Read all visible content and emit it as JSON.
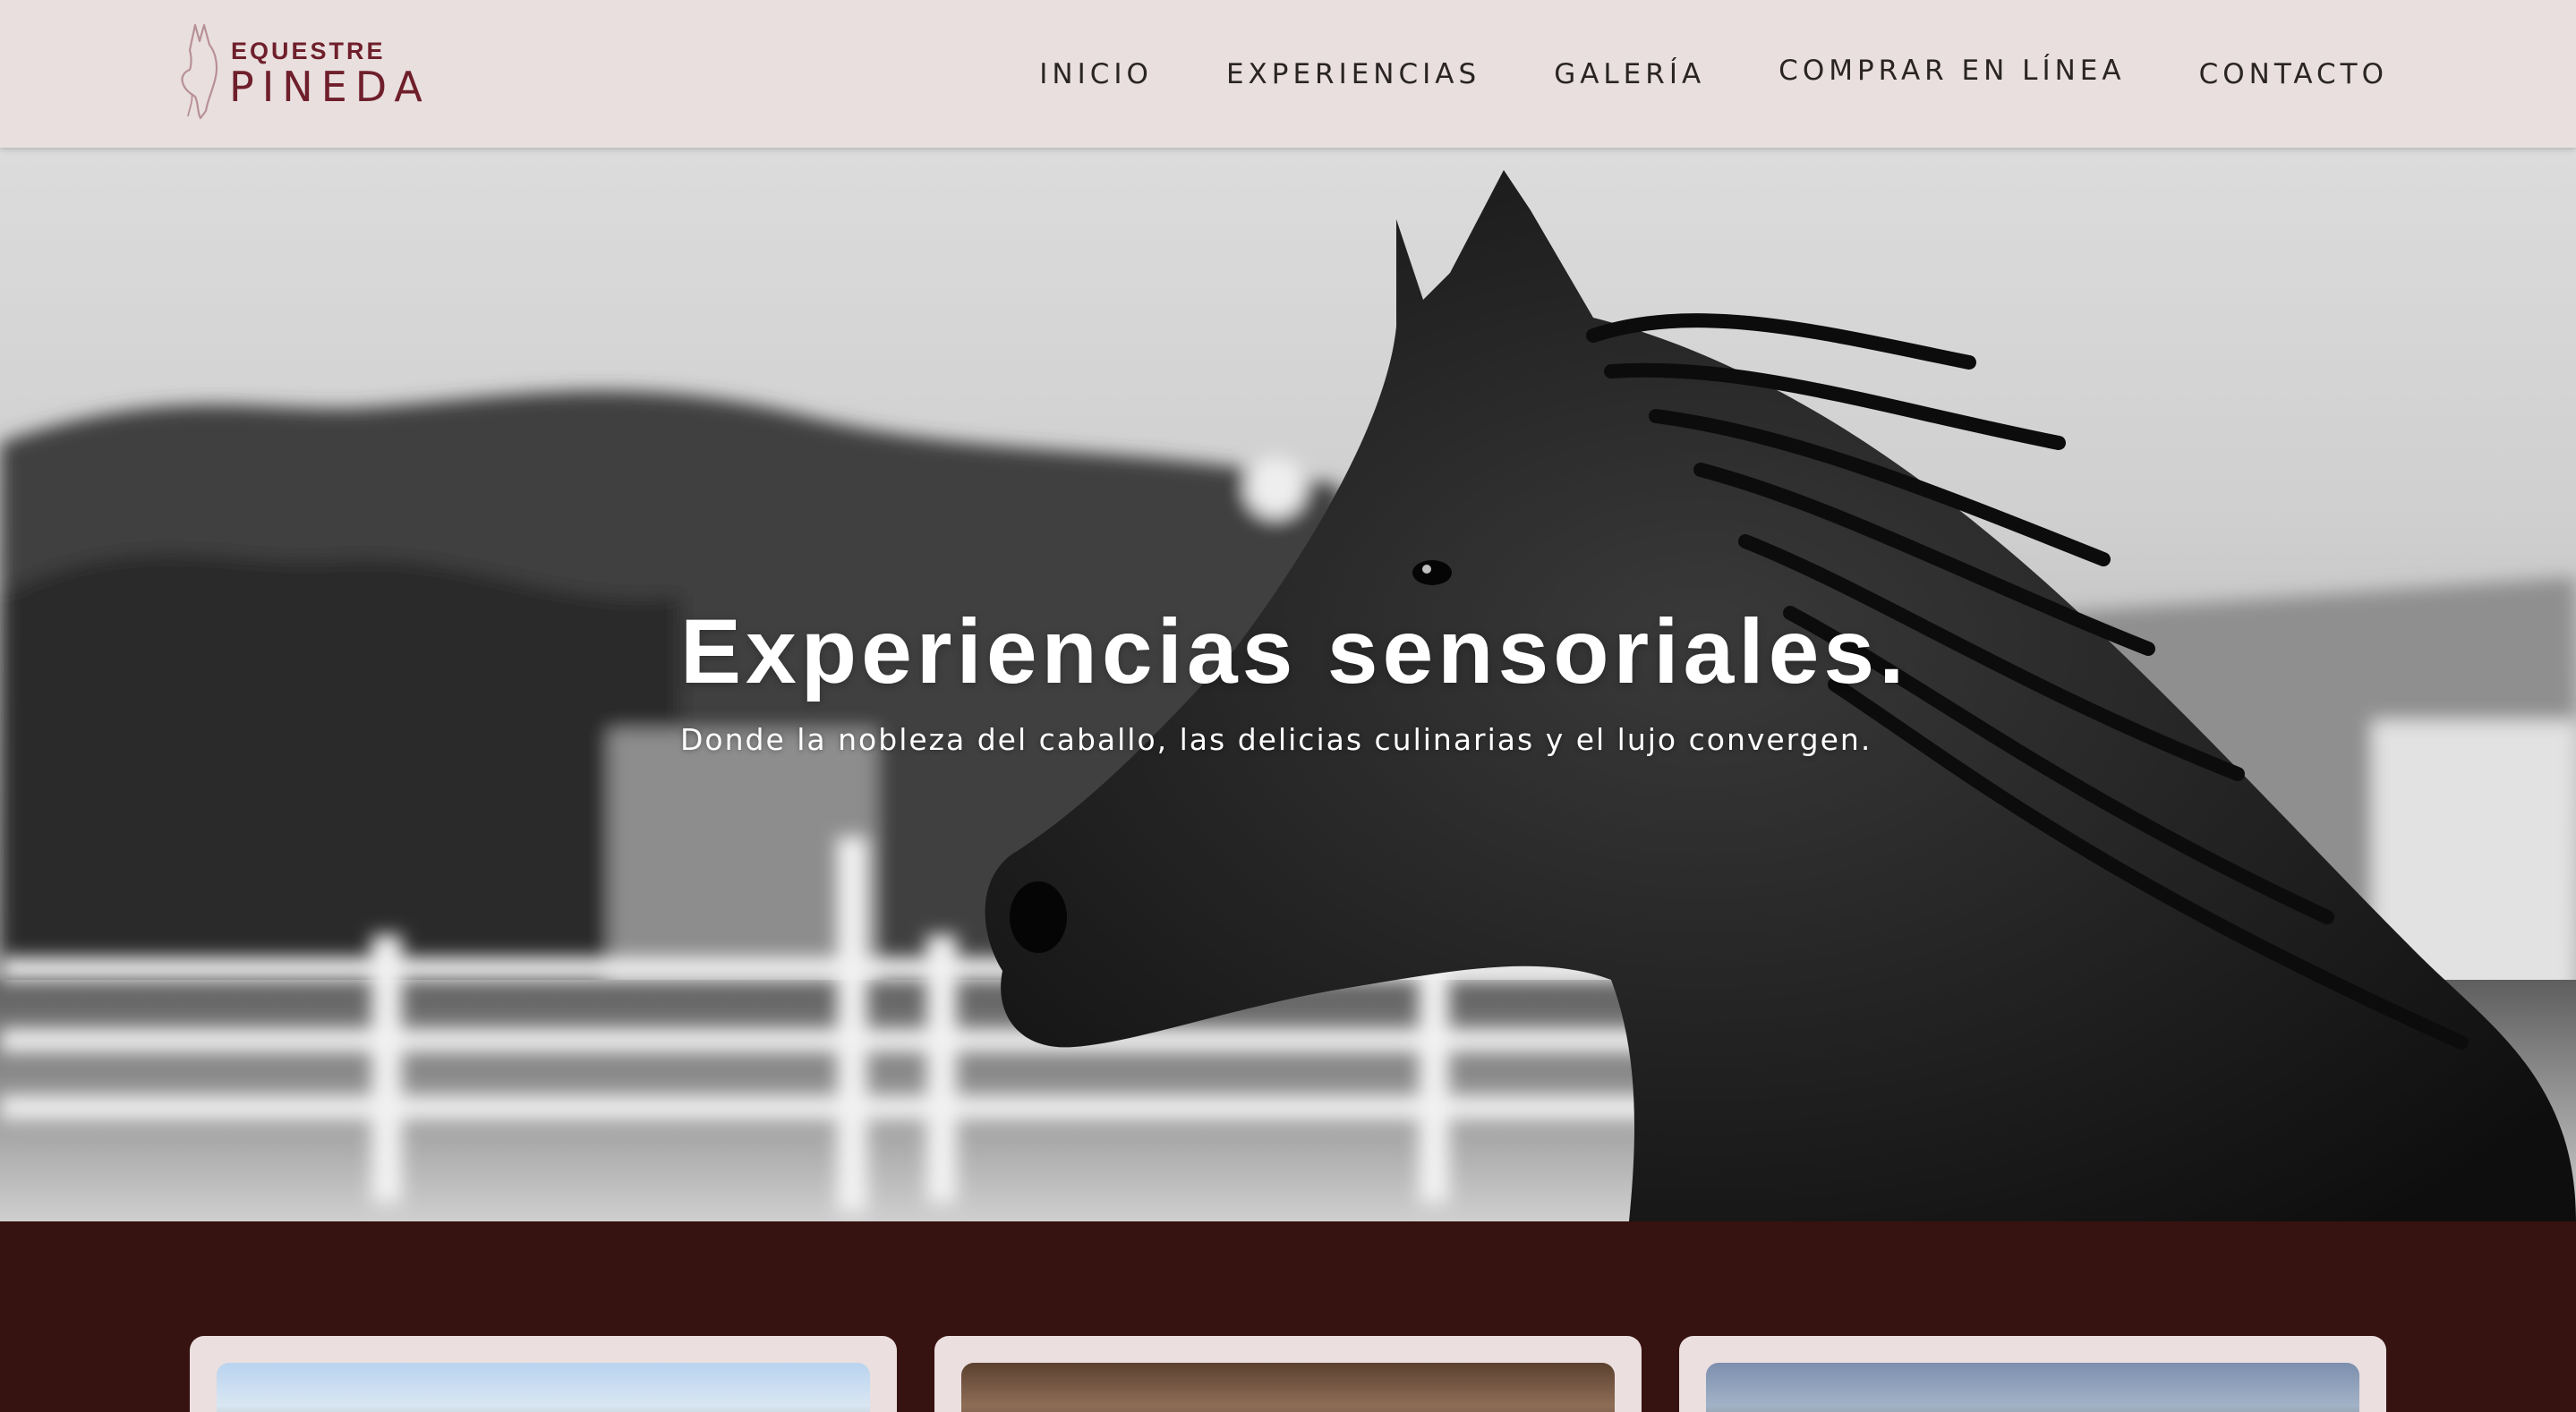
{
  "brand": {
    "top": "EQUESTRE",
    "name": "PINEDA",
    "color": "#6f1f2b",
    "icon": "horse-head-logo-icon"
  },
  "nav": {
    "items": [
      {
        "label": "INICIO"
      },
      {
        "label": "EXPERIENCIAS"
      },
      {
        "label": "GALERÍA"
      },
      {
        "label": "COMPRAR EN LÍNEA"
      },
      {
        "label": "CONTACTO"
      }
    ]
  },
  "hero": {
    "title": "Experiencias sensoriales.",
    "subtitle": "Donde la nobleza del caballo, las delicias culinarias y el lujo convergen."
  },
  "colors": {
    "header_bg": "#e9dfdf",
    "section_bg": "#361210",
    "card_bg": "#ebdfdf",
    "text_dark": "#2a2424"
  }
}
